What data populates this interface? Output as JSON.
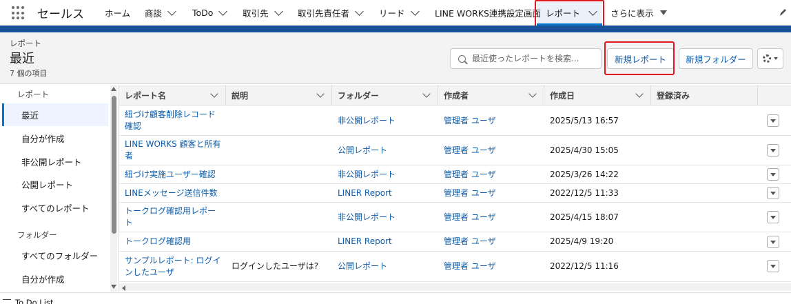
{
  "app": {
    "name": "セールス"
  },
  "nav": {
    "items": [
      {
        "label": "ホーム",
        "dropdown": false
      },
      {
        "label": "商談",
        "dropdown": true
      },
      {
        "label": "ToDo",
        "dropdown": true
      },
      {
        "label": "取引先",
        "dropdown": true
      },
      {
        "label": "取引先責任者",
        "dropdown": true
      },
      {
        "label": "リード",
        "dropdown": true
      },
      {
        "label": "LINE WORKS連携設定画面",
        "dropdown": false
      },
      {
        "label": "レポート",
        "dropdown": true,
        "active": true
      }
    ],
    "more_label": "さらに表示",
    "edit_icon": "pencil-icon"
  },
  "header": {
    "eyebrow": "レポート",
    "title": "最近",
    "count": "7 個の項目",
    "search_placeholder": "最近使ったレポートを検索...",
    "new_report_label": "新規レポート",
    "new_folder_label": "新規フォルダー"
  },
  "sidebar": {
    "reports_group": "レポート",
    "report_items": [
      {
        "label": "最近",
        "active": true
      },
      {
        "label": "自分が作成"
      },
      {
        "label": "非公開レポート"
      },
      {
        "label": "公開レポート"
      },
      {
        "label": "すべてのレポート"
      }
    ],
    "folders_group": "フォルダー",
    "folder_items": [
      {
        "label": "すべてのフォルダー"
      },
      {
        "label": "自分が作成"
      }
    ]
  },
  "table": {
    "columns": [
      "レポート名",
      "説明",
      "フォルダー",
      "作成者",
      "作成日",
      "登録済み"
    ],
    "rows": [
      {
        "name": "紐づけ顧客削除レコード確認",
        "description": "",
        "folder": "非公開レポート",
        "owner": "管理者 ユーザ",
        "created": "2025/5/13 16:57"
      },
      {
        "name": "LINE WORKS 顧客と所有者",
        "description": "",
        "folder": "公開レポート",
        "owner": "管理者 ユーザ",
        "created": "2025/4/30 15:05"
      },
      {
        "name": "紐づけ実施ユーザー確認",
        "description": "",
        "folder": "非公開レポート",
        "owner": "管理者 ユーザ",
        "created": "2025/3/26 14:22"
      },
      {
        "name": "LINEメッセージ送信件数",
        "description": "",
        "folder": "LINER Report",
        "owner": "管理者 ユーザ",
        "created": "2022/12/5 11:33"
      },
      {
        "name": "トークログ確認用レポート",
        "description": "",
        "folder": "非公開レポート",
        "owner": "管理者 ユーザ",
        "created": "2025/4/15 18:07"
      },
      {
        "name": "トークログ確認用",
        "description": "",
        "folder": "LINER Report",
        "owner": "管理者 ユーザ",
        "created": "2025/4/9 19:20"
      },
      {
        "name": "サンプルレポート: ログインしたユーザ",
        "description": "ログインしたユーザは?",
        "folder": "公開レポート",
        "owner": "管理者 ユーザ",
        "created": "2022/12/5 11:16"
      }
    ]
  },
  "footer": {
    "label": "To Do List"
  },
  "colors": {
    "brand_bar": "#1b5297",
    "link": "#0b5cab",
    "highlight": "#e0181f"
  }
}
